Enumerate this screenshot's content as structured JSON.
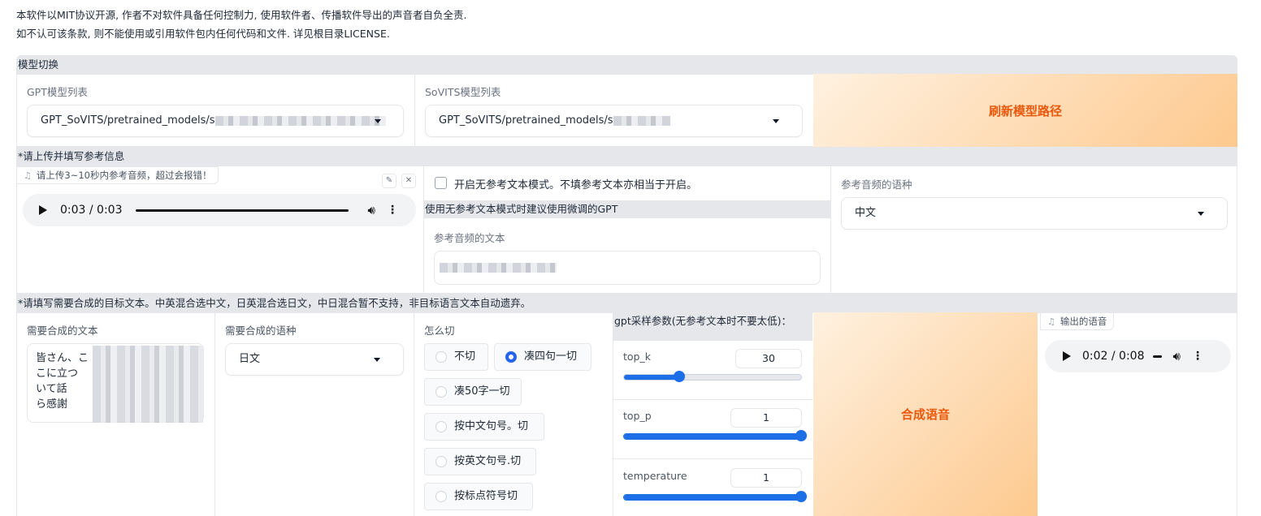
{
  "notice": {
    "line1": "本软件以MIT协议开源, 作者不对软件具备任何控制力, 使用软件者、传播软件导出的声音者自负全责.",
    "line2": "如不认可该条款, 则不能使用或引用软件包内任何代码和文件. 详见根目录LICENSE."
  },
  "model_switch": {
    "title": "模型切换",
    "gpt_label": "GPT模型列表",
    "gpt_value": "GPT_SoVITS/pretrained_models/s",
    "sovits_label": "SoVITS模型列表",
    "sovits_value": "GPT_SoVITS/pretrained_models/s",
    "refresh_button": "刷新模型路径"
  },
  "reference": {
    "title": "*请上传并填写参考信息",
    "audio_tag": "请上传3~10秒内参考音频，超过会报错！",
    "audio_time": "0:03 / 0:03",
    "audio_progress": 1.0,
    "no_ref_checkbox": "开启无参考文本模式。不填参考文本亦相当于开启。",
    "no_ref_checked": false,
    "hint": "使用无参考文本模式时建议使用微调的GPT",
    "ref_text_label": "参考音频的文本",
    "ref_lang_label": "参考音频的语种",
    "ref_lang_value": "中文"
  },
  "synthesis": {
    "title": "*请填写需要合成的目标文本。中英混合选中文，日英混合选日文，中日混合暂不支持，非目标语言文本自动遗弃。",
    "text_label": "需要合成的文本",
    "text_lines": [
      "皆さん、こ",
      "こに立つ",
      "いて話",
      "ら感謝"
    ],
    "lang_label": "需要合成的语种",
    "lang_value": "日文",
    "cut_label": "怎么切",
    "cut_options": [
      {
        "label": "不切",
        "selected": false
      },
      {
        "label": "凑四句一切",
        "selected": true
      },
      {
        "label": "凑50字一切",
        "selected": false
      },
      {
        "label": "按中文句号。切",
        "selected": false
      },
      {
        "label": "按英文句号.切",
        "selected": false
      },
      {
        "label": "按标点符号切",
        "selected": false
      }
    ],
    "gpt_params_label": "gpt采样参数(无参考文本时不要太低)：",
    "params": [
      {
        "name": "top_k",
        "value": "30",
        "fraction": 0.3
      },
      {
        "name": "top_p",
        "value": "1",
        "fraction": 1.0
      },
      {
        "name": "temperature",
        "value": "1",
        "fraction": 1.0
      }
    ],
    "synth_button": "合成语音",
    "output_tag": "输出的语音",
    "output_time": "0:02 / 0:08"
  },
  "colors": {
    "accent_orange": "#ea580c",
    "slider_blue": "#1d6fe8"
  },
  "icons": {
    "music_note": "music-note-icon",
    "edit": "pencil-icon",
    "close": "close-icon"
  }
}
